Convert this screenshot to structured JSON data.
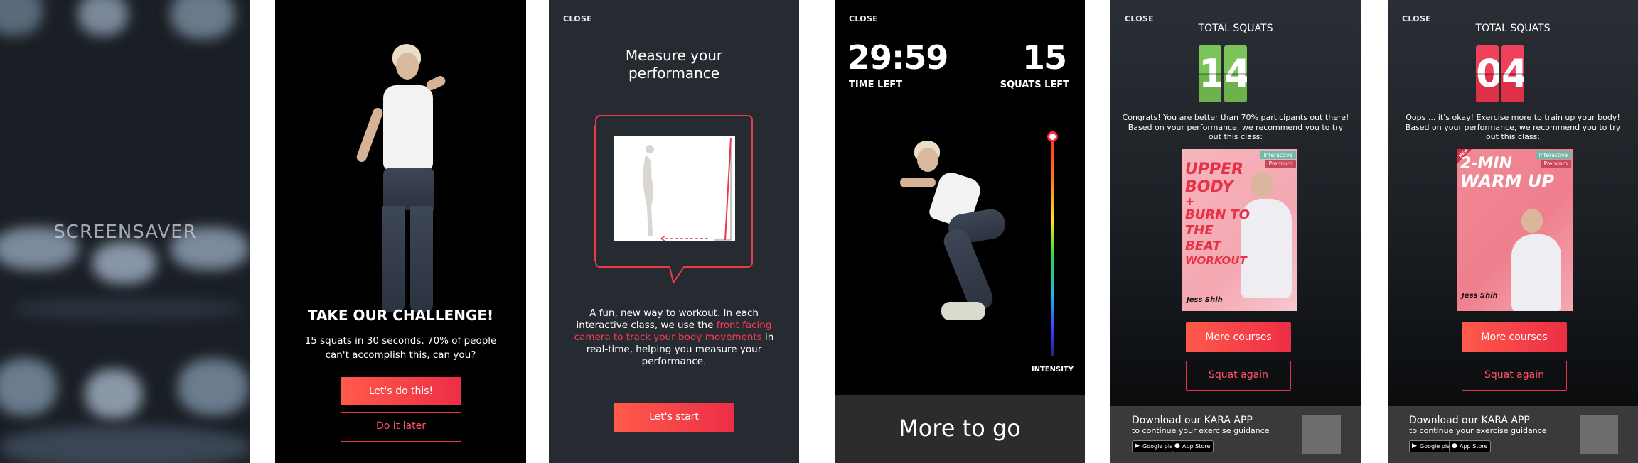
{
  "screensaver": {
    "label": "SCREENSAVER"
  },
  "challenge": {
    "title": "TAKE OUR CHALLENGE!",
    "body": "15 squats in 30 seconds. 70% of people can't accomplish this, can you?",
    "primary_button": "Let's do this!",
    "secondary_button": "Do it later"
  },
  "measure": {
    "close": "CLOSE",
    "title_line1": "Measure your",
    "title_line2": "performance",
    "body_pre": "A fun, new way to workout. In each interactive class, we use the ",
    "body_highlight": "front facing camera to track your body movements",
    "body_post": " in real-time, helping you measure your performance.",
    "button": "Let's start"
  },
  "workout": {
    "close": "CLOSE",
    "time_value": "29:59",
    "time_label": "TIME LEFT",
    "squats_value": "15",
    "squats_label": "SQUATS LEFT",
    "intensity_label": "INTENSITY",
    "banner": "More to go"
  },
  "result_success": {
    "close": "CLOSE",
    "title": "TOTAL SQUATS",
    "digit1": "1",
    "digit2": "4",
    "message": "Congrats! You are better than 70% participants out there! Based on your performance, we recommend you to try out this class:",
    "card": {
      "tag_interactive": "Interactive",
      "tag_premium": "Premium",
      "title_lines": [
        "UPPER",
        "BODY",
        "+",
        "BURN TO",
        "THE",
        "BEAT",
        "WORKOUT"
      ],
      "coach": "Jess Shih"
    },
    "primary_button": "More courses",
    "secondary_button": "Squat again",
    "download_title": "Download our KARA APP",
    "download_sub": "to continue your exercise guidance",
    "google_play": "Google play",
    "app_store": "App Store"
  },
  "result_fail": {
    "close": "CLOSE",
    "title": "TOTAL SQUATS",
    "digit1": "0",
    "digit2": "4",
    "message": "Oops ... it's okay! Exercise more to train up your body! Based on your performance, we recommend you to try out this class:",
    "card": {
      "badge": "NEW",
      "tag_interactive": "Interactive",
      "tag_premium": "Premium",
      "title_line1": "2-MIN",
      "title_line2": "WARM UP",
      "coach": "Jess Shih"
    },
    "primary_button": "More courses",
    "secondary_button": "Squat again",
    "download_title": "Download our KARA APP",
    "download_sub": "to continue your exercise guidance",
    "google_play": "Google play",
    "app_store": "App Store"
  },
  "colors": {
    "accent": "#ec2e46",
    "accent_light": "#ff5a4a",
    "success": "#7cc35a",
    "panel": "#262b31"
  }
}
